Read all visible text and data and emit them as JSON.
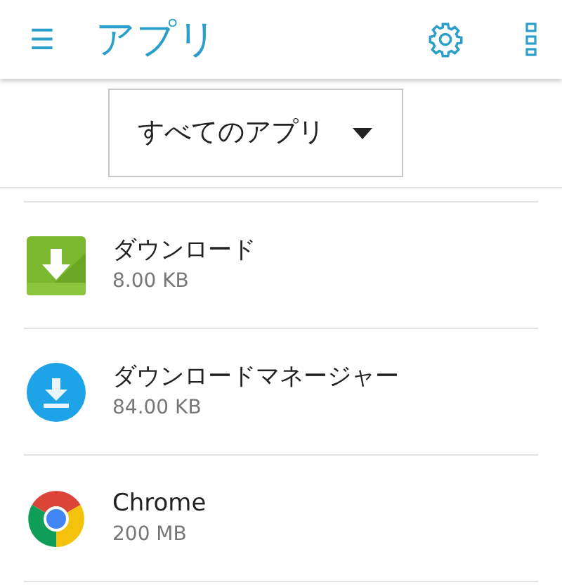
{
  "app_bar": {
    "menu_icon": "☰",
    "title": "アプリ"
  },
  "filter": {
    "value": "すべてのアプリ"
  },
  "apps": [
    {
      "kind": "download-box",
      "name": "ダウンロード",
      "size": "8.00 KB"
    },
    {
      "kind": "download-circle",
      "name": "ダウンロードマネージャー",
      "size": "84.00 KB"
    },
    {
      "kind": "browser",
      "name": "Chrome",
      "size": "200 MB"
    }
  ]
}
